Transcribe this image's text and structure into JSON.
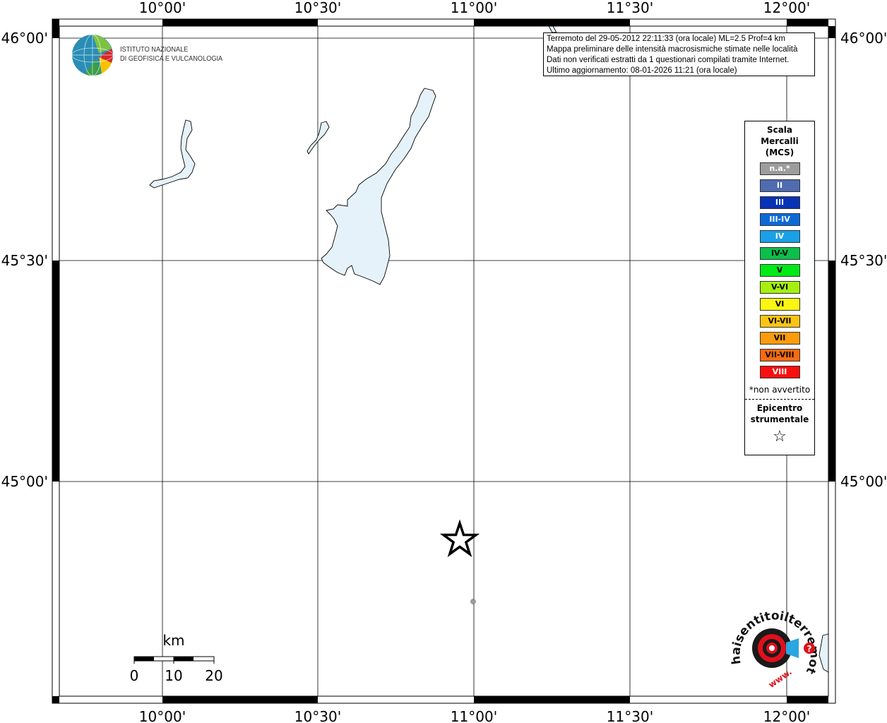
{
  "map": {
    "lon_labels": [
      "10°00'",
      "10°30'",
      "11°00'",
      "11°30'",
      "12°00'"
    ],
    "lat_labels": [
      "46°00'",
      "45°30'",
      "45°00'"
    ],
    "colors": {
      "lake": "#e6f2fa",
      "lake_outline": "#000000",
      "grid": "#000000",
      "background": "#ffffff"
    }
  },
  "info": {
    "line1": "Terremoto del 29-05-2012 22:11:33 (ora locale) ML=2.5 Prof=4 km",
    "line2": "Mappa preliminare delle intensità macrosismiche stimate nelle località",
    "line3": "Dati non verificati estratti da 1 questionari compilati tramite Internet.",
    "line4": "Ultimo aggiornamento: 08-01-2026 11:21 (ora locale)"
  },
  "logo_ingv": {
    "line1": "ISTITUTO NAZIONALE",
    "line2": "DI GEOFISICA E VULCANOLOGIA"
  },
  "legend": {
    "title1": "Scala",
    "title2": "Mercalli",
    "title3": "(MCS)",
    "items": [
      {
        "label": "n.a.*",
        "color": "#9c9c9c",
        "text": "#ffffff"
      },
      {
        "label": "II",
        "color": "#4f6cb0",
        "text": "#ffffff"
      },
      {
        "label": "III",
        "color": "#0833b5",
        "text": "#ffffff"
      },
      {
        "label": "III-IV",
        "color": "#0a6ad8",
        "text": "#ffffff"
      },
      {
        "label": "IV",
        "color": "#1aa0e6",
        "text": "#ffffff"
      },
      {
        "label": "IV-V",
        "color": "#0bbf4a",
        "text": "#000000"
      },
      {
        "label": "V",
        "color": "#00ea16",
        "text": "#000000"
      },
      {
        "label": "V-VI",
        "color": "#a6f010",
        "text": "#000000"
      },
      {
        "label": "VI",
        "color": "#fbf612",
        "text": "#000000"
      },
      {
        "label": "VI-VII",
        "color": "#fbc512",
        "text": "#000000"
      },
      {
        "label": "VII",
        "color": "#fb9c0c",
        "text": "#000000"
      },
      {
        "label": "VII-VIII",
        "color": "#f86a10",
        "text": "#000000"
      },
      {
        "label": "VIII",
        "color": "#f81010",
        "text": "#ffffff"
      }
    ],
    "note": "*non avvertito",
    "epi1": "Epicentro",
    "epi2": "strumentale",
    "epi_icon": "star-outline-icon"
  },
  "scalebar": {
    "unit": "km",
    "ticks": [
      "0",
      "10",
      "20"
    ]
  },
  "epicenter": {
    "lon": 10.96,
    "lat": 44.87
  },
  "logo_hst": {
    "text": "haisentitoilterremoto.it",
    "prefix": "www."
  }
}
